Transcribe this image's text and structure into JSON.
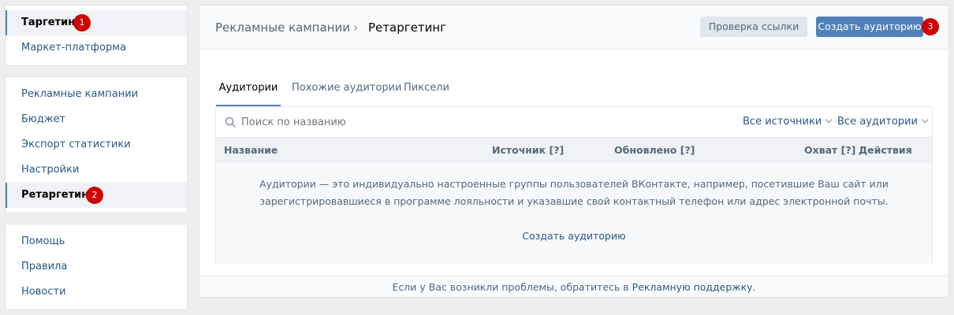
{
  "sidebar": {
    "group1": [
      {
        "label": "Таргетинг",
        "badge": "1"
      },
      {
        "label": "Маркет-платформа"
      }
    ],
    "group2": [
      {
        "label": "Рекламные кампании"
      },
      {
        "label": "Бюджет"
      },
      {
        "label": "Экспорт статистики"
      },
      {
        "label": "Настройки"
      },
      {
        "label": "Ретаргетинг",
        "badge": "2"
      }
    ],
    "group3": [
      {
        "label": "Помощь"
      },
      {
        "label": "Правила"
      },
      {
        "label": "Новости"
      }
    ]
  },
  "header": {
    "breadcrumb_root": "Рекламные кампании",
    "breadcrumb_current": "Ретаргетинг",
    "check_link_label": "Проверка ссылки",
    "create_audience_label": "Создать аудиторию",
    "create_badge": "3"
  },
  "tabs": [
    {
      "label": "Аудитории",
      "active": true
    },
    {
      "label": "Похожие аудитории"
    },
    {
      "label": "Пиксели"
    }
  ],
  "search": {
    "placeholder": "Поиск по названию"
  },
  "filters": {
    "sources": "Все источники",
    "audiences": "Все аудитории"
  },
  "table": {
    "columns": [
      "Название",
      "Источник [?]",
      "Обновлено [?]",
      "Охват [?]",
      "Действия"
    ]
  },
  "empty_state": {
    "line1": "Аудитории — это индивидуально настроенные группы пользователей ВКонтакте, например, посетившие Ваш сайт или",
    "line2": "зарегистрировавшиеся в программе лояльности и указавшие свой контактный телефон или адрес электронной почты.",
    "create_link": "Создать аудиторию"
  },
  "footer": {
    "text": "Если у Вас возникли проблемы, обратитесь в",
    "link": "Рекламную поддержку",
    "period": "."
  },
  "colors": {
    "accent": "#5181b8",
    "link": "#2a5885",
    "badge": "#d00000"
  }
}
